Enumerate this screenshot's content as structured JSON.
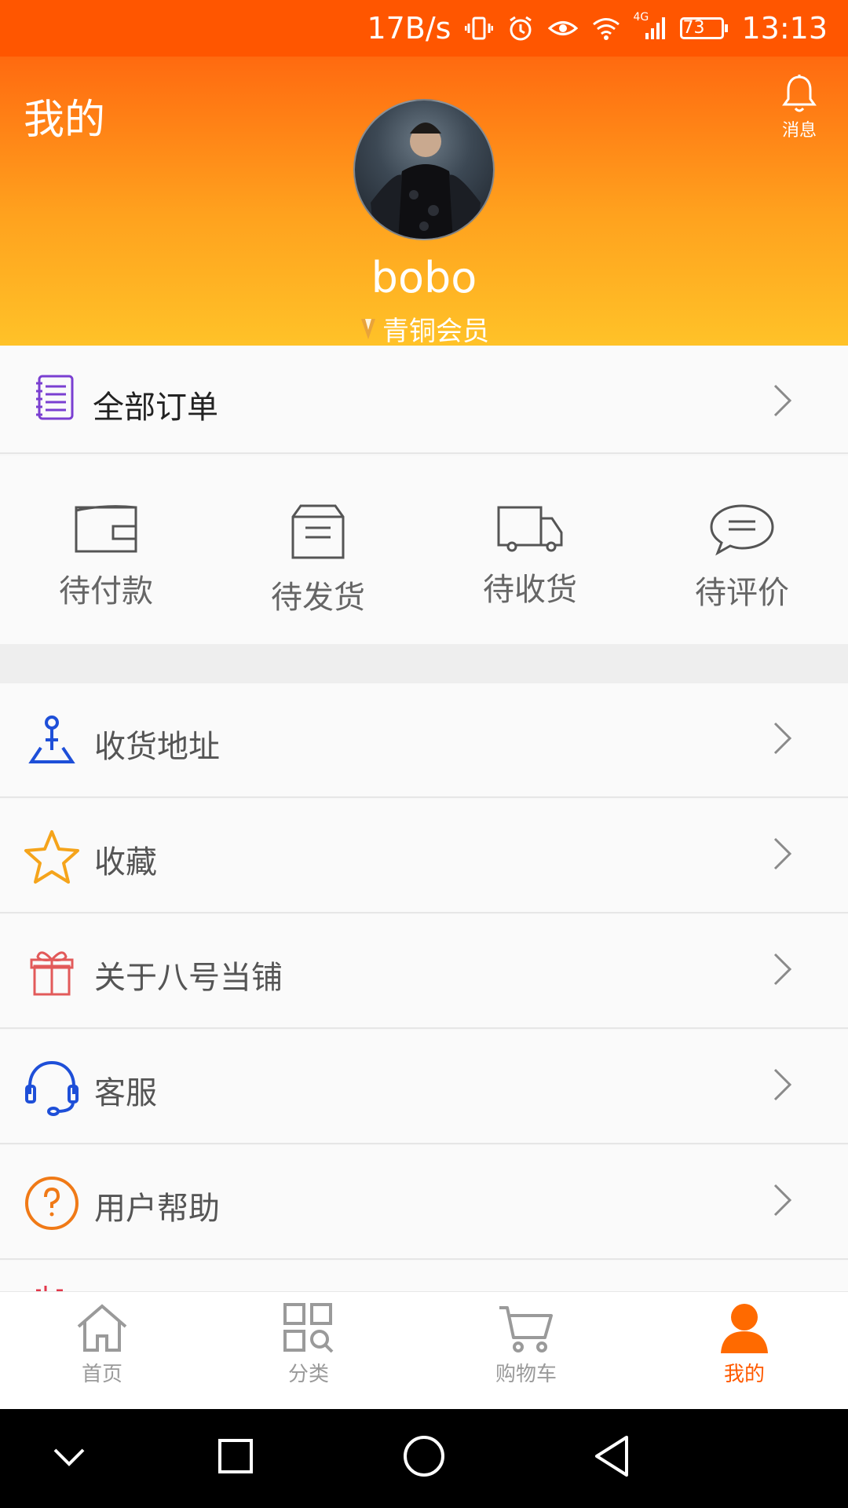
{
  "status_bar": {
    "net_speed": "17B/s",
    "network": "4G",
    "battery": "73",
    "time": "13:13"
  },
  "header": {
    "title": "我的",
    "message_label": "消息",
    "username": "bobo",
    "member_level": "青铜会员"
  },
  "orders": {
    "all_label": "全部订单",
    "statuses": [
      "待付款",
      "待发货",
      "待收货",
      "待评价"
    ]
  },
  "menu": {
    "address": "收货地址",
    "favorites": "收藏",
    "about": "关于八号当铺",
    "service": "客服",
    "help": "用户帮助"
  },
  "bottom_nav": {
    "home": "首页",
    "category": "分类",
    "cart": "购物车",
    "mine": "我的"
  },
  "colors": {
    "accent": "#ff5a00",
    "status_bar": "#ff5600",
    "header_top": "#ff6a10",
    "header_bottom": "#ffc228"
  }
}
